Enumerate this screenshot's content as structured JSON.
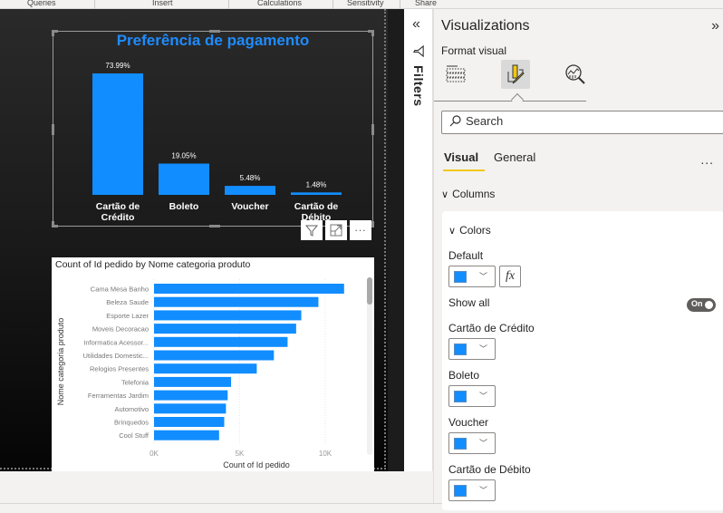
{
  "ribbon": {
    "groups": [
      "Queries",
      "Insert",
      "Calculations",
      "Sensitivity",
      "Share"
    ]
  },
  "visuals": {
    "payment_chart": {
      "title": "Preferência de pagamento",
      "color": "#118dff",
      "toolbar": {
        "filter_icon": "funnel-icon",
        "focus_icon": "focus-mode-icon",
        "more_icon": "more-options-icon"
      }
    },
    "category_chart": {
      "title": "Count of Id pedido by Nome categoria produto",
      "color": "#118dff"
    }
  },
  "chart_data": [
    {
      "type": "bar",
      "orientation": "vertical",
      "title": "Preferência de pagamento",
      "categories": [
        "Cartão de Crédito",
        "Boleto",
        "Voucher",
        "Cartão de Débito"
      ],
      "category_lines": [
        [
          "Cartão de",
          "Crédito"
        ],
        [
          "Boleto"
        ],
        [
          "Voucher"
        ],
        [
          "Cartão de",
          "Débito"
        ]
      ],
      "values": [
        73.99,
        19.05,
        5.48,
        1.48
      ],
      "data_labels": [
        "73.99%",
        "19.05%",
        "5.48%",
        "1.48%"
      ],
      "unit": "%",
      "ylim": [
        0,
        73.99
      ],
      "grid": false,
      "legend": "none"
    },
    {
      "type": "bar",
      "orientation": "horizontal",
      "title": "Count of Id pedido by Nome categoria produto",
      "categories": [
        "Cama Mesa Banho",
        "Beleza Saude",
        "Esporte Lazer",
        "Moveis Decoracao",
        "Informatica Acessor...",
        "Utilidades Domestic...",
        "Relogios Presentes",
        "Telefonia",
        "Ferramentas Jardim",
        "Automotivo",
        "Brinquedos",
        "Cool Stuff"
      ],
      "values": [
        11100,
        9600,
        8600,
        8300,
        7800,
        7000,
        6000,
        4500,
        4300,
        4200,
        4100,
        3800
      ],
      "xlabel": "Count of Id pedido",
      "ylabel": "Nome categoria produto",
      "xticks": [
        0,
        5000,
        10000
      ],
      "xtick_labels": [
        "0K",
        "5K",
        "10K"
      ],
      "xlim": [
        0,
        11100
      ],
      "grid": true,
      "legend": "none"
    }
  ],
  "filters": {
    "label": "Filters",
    "collapse_icon": "double-chevron-left-icon",
    "funnel_icon": "funnel-icon"
  },
  "viz_pane": {
    "title": "Visualizations",
    "expand_icon": "double-chevron-right-icon",
    "format_label": "Format visual",
    "format_icons": [
      "build-visual-icon",
      "format-paintbrush-icon",
      "analytics-icon"
    ],
    "active_format_icon": "format-paintbrush-icon",
    "search_placeholder": "Search",
    "tabs": [
      {
        "label": "Visual",
        "active": true
      },
      {
        "label": "General",
        "active": false
      }
    ],
    "more_label": "...",
    "sections": {
      "columns": "Columns",
      "colors": "Colors"
    },
    "colors": {
      "default_label": "Default",
      "default_color": "#118dff",
      "fx_label": "fx",
      "show_all_label": "Show all",
      "show_all_state": "On",
      "series": [
        {
          "label": "Cartão de Crédito",
          "color": "#118dff"
        },
        {
          "label": "Boleto",
          "color": "#118dff"
        },
        {
          "label": "Voucher",
          "color": "#118dff"
        },
        {
          "label": "Cartão de Débito",
          "color": "#118dff"
        }
      ]
    }
  }
}
